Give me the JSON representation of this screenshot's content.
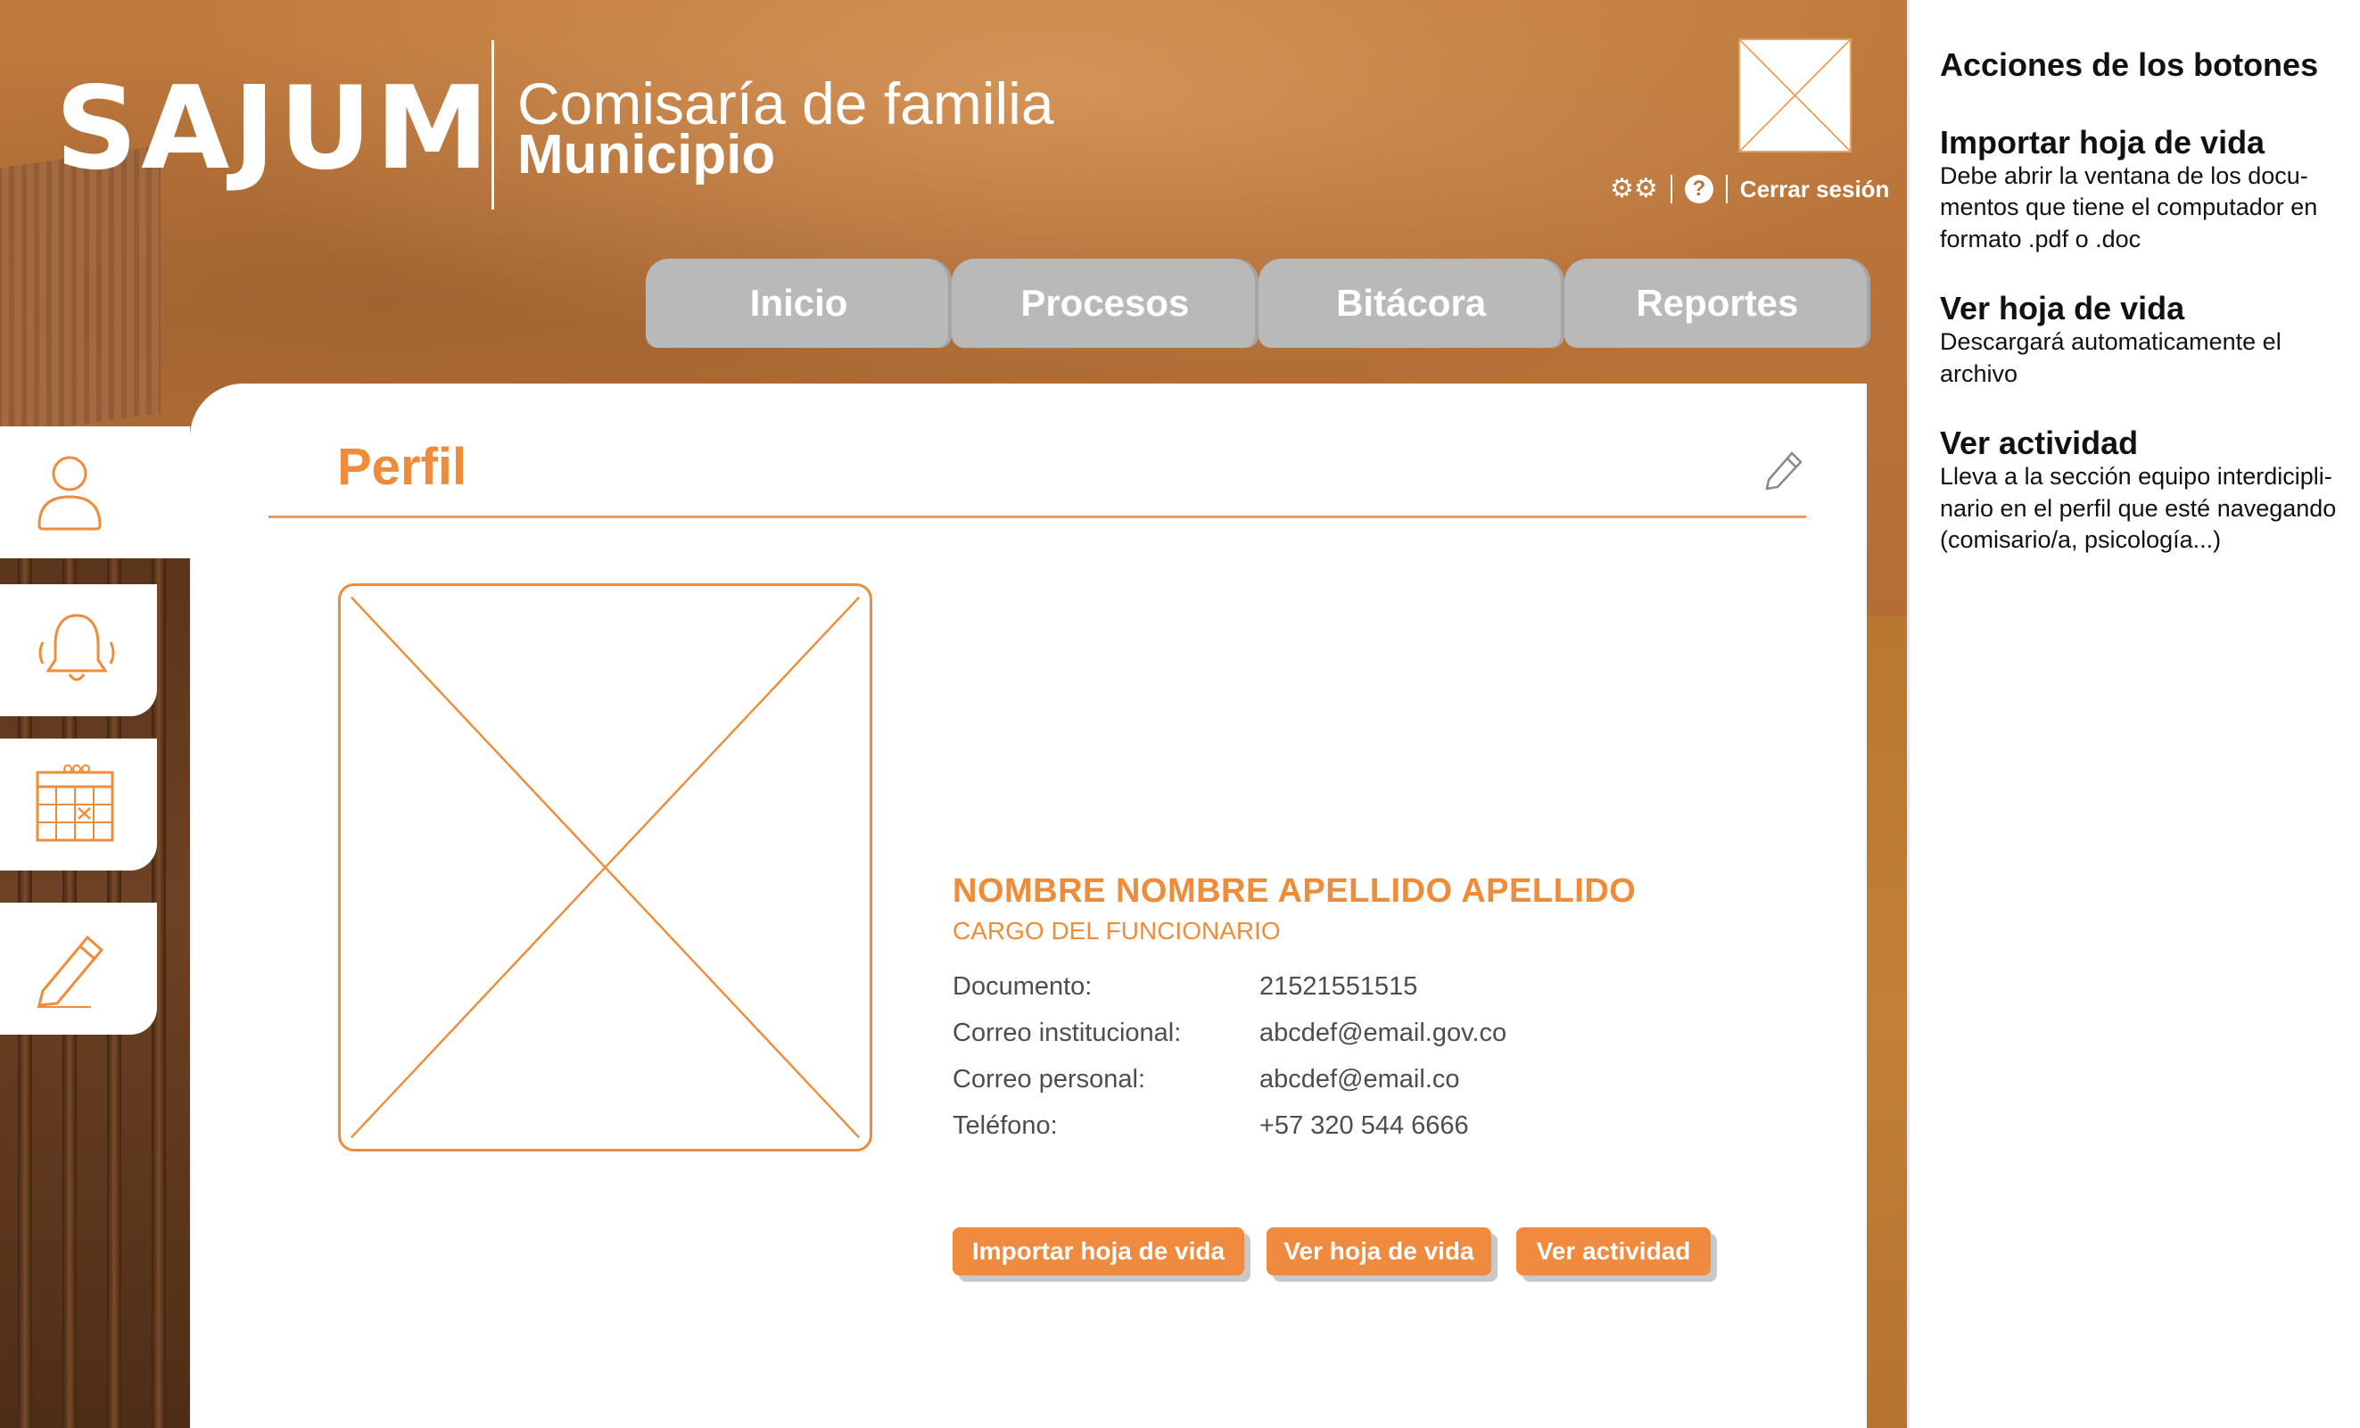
{
  "header": {
    "logo": "SAJUM",
    "subtitle_line1": "Comisaría de familia",
    "subtitle_line2": "Municipio",
    "logout_label": "Cerrar sesión",
    "help_glyph": "?",
    "settings_icon": "gears-icon",
    "help_icon": "help-icon",
    "avatar_icon": "image-placeholder-icon"
  },
  "nav": {
    "tabs": [
      {
        "label": "Inicio"
      },
      {
        "label": "Procesos"
      },
      {
        "label": "Bitácora"
      },
      {
        "label": "Reportes"
      }
    ]
  },
  "sidebar": {
    "items": [
      {
        "icon": "user-icon"
      },
      {
        "icon": "bell-icon"
      },
      {
        "icon": "calendar-icon"
      },
      {
        "icon": "pencil-icon"
      }
    ]
  },
  "profile": {
    "title": "Perfil",
    "name": "NOMBRE NOMBRE APELLIDO APELLIDO",
    "role": "CARGO DEL FUNCIONARIO",
    "fields": [
      {
        "label": "Documento:",
        "value": "21521551515"
      },
      {
        "label": "Correo institucional:",
        "value": "abcdef@email.gov.co"
      },
      {
        "label": "Correo personal:",
        "value": "abcdef@email.co"
      },
      {
        "label": "Teléfono:",
        "value": "+57 320 544 6666"
      }
    ],
    "buttons": {
      "import_cv": "Importar hoja de vida",
      "view_cv": "Ver hoja de vida",
      "view_activity": "Ver actividad"
    }
  },
  "annotations": {
    "heading": "Acciones de los botones",
    "items": [
      {
        "title": "Importar hoja de vida",
        "description": "Debe abrir la ventana de los docu-mentos que tiene el computador en formato .pdf o .doc"
      },
      {
        "title": "Ver hoja de vida",
        "description": "Descargará automaticamente el archivo"
      },
      {
        "title": "Ver actividad",
        "description": "Lleva a la sección equipo interdicipli-nario en el perfil que esté navegando (comisario/a, psicología...)"
      }
    ]
  },
  "colors": {
    "accent": "#ef8c3a",
    "button": "#f08a3e",
    "tab": "#b9b9b9",
    "text": "#4d4d4d"
  }
}
